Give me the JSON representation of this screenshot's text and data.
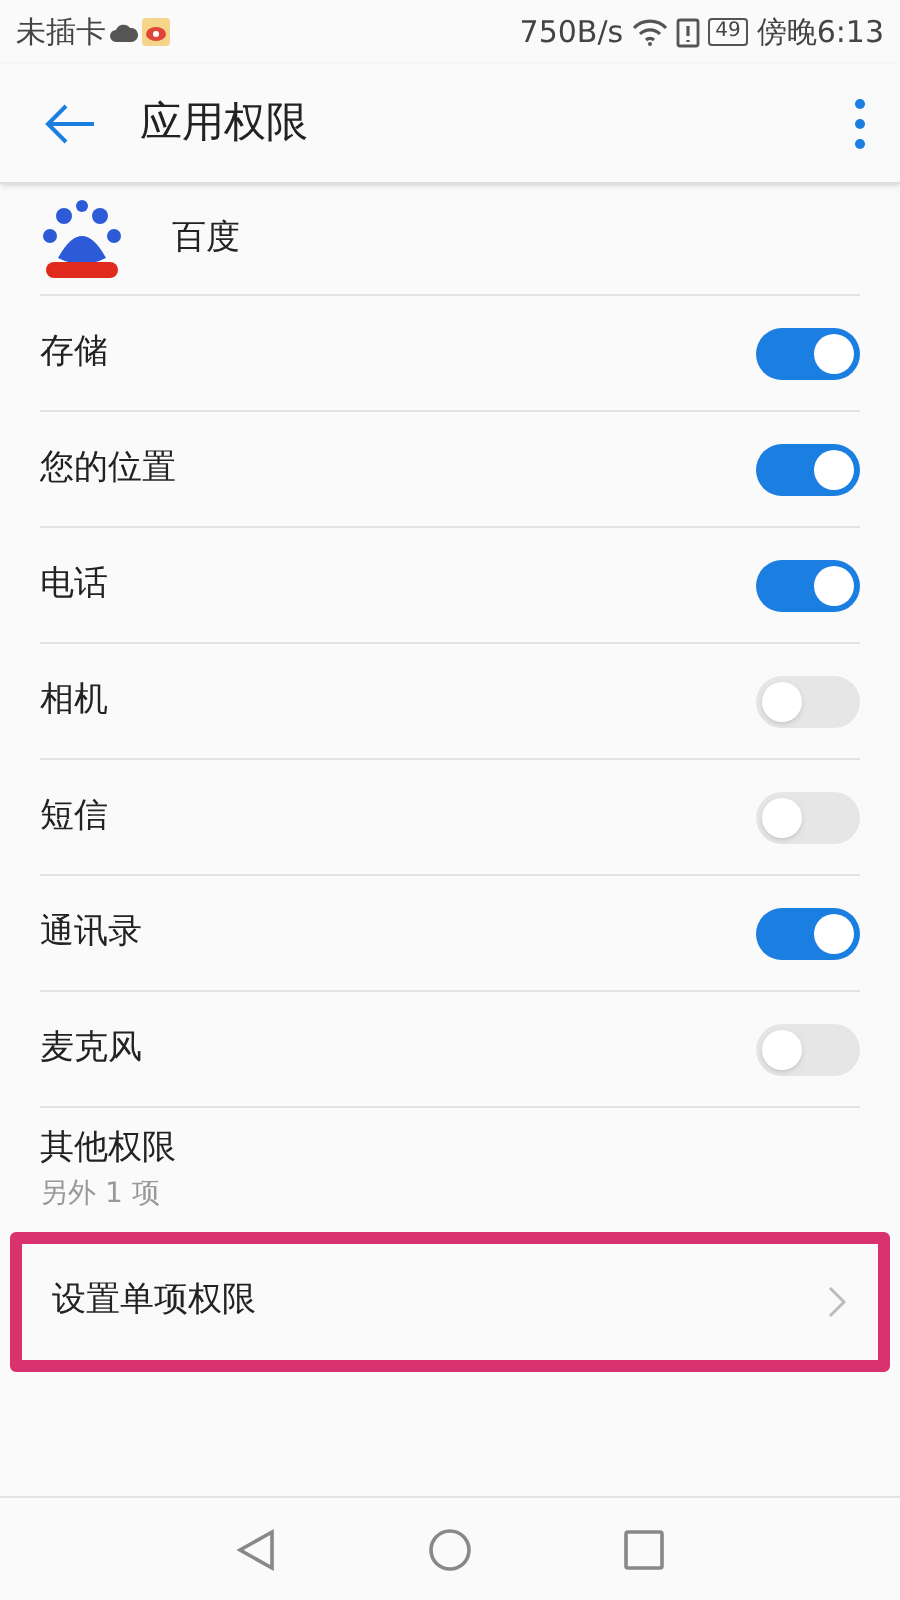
{
  "status_bar": {
    "carrier": "未插卡",
    "speed": "750B/s",
    "battery": "49",
    "time": "傍晚6:13"
  },
  "toolbar": {
    "title": "应用权限"
  },
  "app": {
    "name": "百度"
  },
  "permissions": [
    {
      "label": "存储",
      "on": true
    },
    {
      "label": "您的位置",
      "on": true
    },
    {
      "label": "电话",
      "on": true
    },
    {
      "label": "相机",
      "on": false
    },
    {
      "label": "短信",
      "on": false
    },
    {
      "label": "通讯录",
      "on": true
    },
    {
      "label": "麦克风",
      "on": false
    }
  ],
  "other": {
    "title": "其他权限",
    "subtitle": "另外 1 项"
  },
  "single": {
    "label": "设置单项权限",
    "highlighted": true
  }
}
